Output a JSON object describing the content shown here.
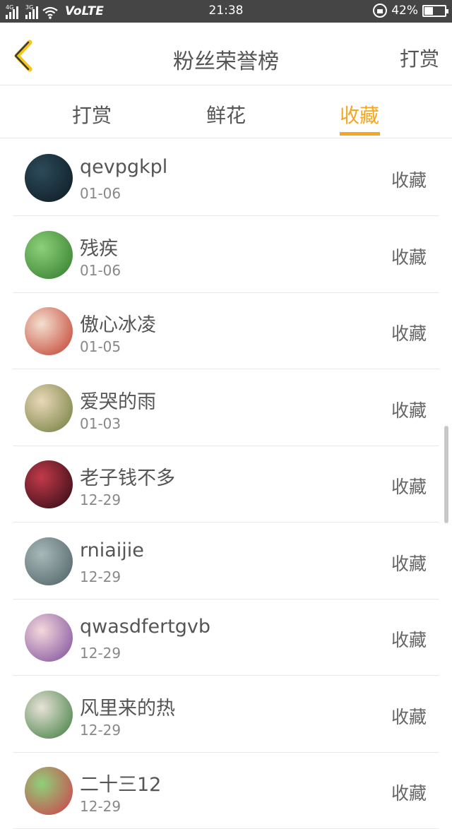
{
  "status_bar": {
    "net1": "4G",
    "net2": "3G",
    "volte": "VoLTE",
    "time": "21:38",
    "battery": "42%",
    "battery_level": 0.42
  },
  "header": {
    "title": "粉丝荣誉榜",
    "right_action": "打赏"
  },
  "tabs": [
    {
      "label": "打赏",
      "active": false
    },
    {
      "label": "鲜花",
      "active": false
    },
    {
      "label": "收藏",
      "active": true
    }
  ],
  "list": [
    {
      "name": "qevpgkpl",
      "date": "01-06",
      "action": "收藏",
      "avatar_colors": [
        "#2d4a5a",
        "#0c1a22"
      ]
    },
    {
      "name": "残疾",
      "date": "01-06",
      "action": "收藏",
      "avatar_colors": [
        "#8ed07a",
        "#2f7a2a"
      ]
    },
    {
      "name": "傲心冰凌",
      "date": "01-05",
      "action": "收藏",
      "avatar_colors": [
        "#f3e0d0",
        "#c23a2a"
      ]
    },
    {
      "name": "爱哭的雨",
      "date": "01-03",
      "action": "收藏",
      "avatar_colors": [
        "#e9d8b8",
        "#6e7a3a"
      ]
    },
    {
      "name": "老子钱不多",
      "date": "12-29",
      "action": "收藏",
      "avatar_colors": [
        "#c23a4a",
        "#2a0a12"
      ]
    },
    {
      "name": "rniaijie",
      "date": "12-29",
      "action": "收藏",
      "avatar_colors": [
        "#a9b9b9",
        "#4a5e62"
      ]
    },
    {
      "name": "qwasdfertgvb",
      "date": "12-29",
      "action": "收藏",
      "avatar_colors": [
        "#f4d8dc",
        "#7a4a9a"
      ]
    },
    {
      "name": "风里来的热",
      "date": "12-29",
      "action": "收藏",
      "avatar_colors": [
        "#e8e2d8",
        "#3a7a3a"
      ]
    },
    {
      "name": "二十三12",
      "date": "12-29",
      "action": "收藏",
      "avatar_colors": [
        "#8fd07a",
        "#d23a4a"
      ]
    }
  ],
  "colors": {
    "accent": "#f5a623",
    "status_bar_bg": "#454545",
    "text_primary": "#555555",
    "text_secondary": "#888888"
  }
}
